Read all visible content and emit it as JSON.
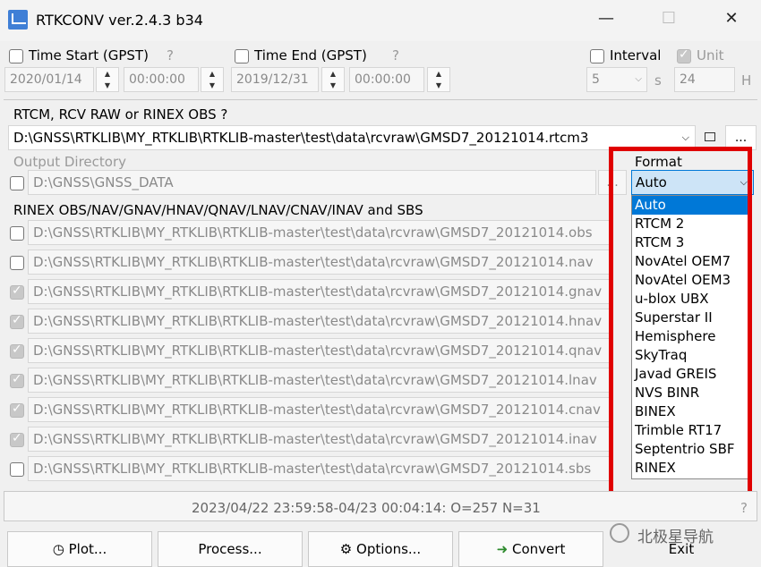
{
  "window": {
    "title": "RTKCONV ver.2.4.3 b34",
    "minimize": "—",
    "maximize": "☐",
    "close": "✕"
  },
  "time_start": {
    "label": "Time Start (GPST)",
    "help": "?",
    "date": "2020/01/14",
    "time": "00:00:00"
  },
  "time_end": {
    "label": "Time End (GPST)",
    "help": "?",
    "date": "2019/12/31",
    "time": "00:00:00"
  },
  "interval": {
    "label": "Interval",
    "value": "5",
    "unit": "s"
  },
  "unit": {
    "label": "Unit",
    "value": "24",
    "unit": "H"
  },
  "input": {
    "label": "RTCM, RCV RAW or RINEX OBS ?",
    "path": "D:\\GNSS\\RTKLIB\\MY_RTKLIB\\RTKLIB-master\\test\\data\\rcvraw\\GMSD7_20121014.rtcm3",
    "browse": "..."
  },
  "output_dir": {
    "label": "Output Directory",
    "path": "D:\\GNSS\\GNSS_DATA",
    "browse": "..."
  },
  "format": {
    "label": "Format",
    "selected": "Auto",
    "options": [
      "Auto",
      "RTCM 2",
      "RTCM 3",
      "NovAtel OEM7",
      "NovAtel OEM3",
      "u-blox UBX",
      "Superstar II",
      "Hemisphere",
      "SkyTraq",
      "Javad GREIS",
      "NVS BINR",
      "BINEX",
      "Trimble RT17",
      "Septentrio SBF",
      "RINEX"
    ]
  },
  "rinex": {
    "label": "RINEX OBS/NAV/GNAV/HNAV/QNAV/LNAV/CNAV/INAV and SBS",
    "files": [
      "D:\\GNSS\\RTKLIB\\MY_RTKLIB\\RTKLIB-master\\test\\data\\rcvraw\\GMSD7_20121014.obs",
      "D:\\GNSS\\RTKLIB\\MY_RTKLIB\\RTKLIB-master\\test\\data\\rcvraw\\GMSD7_20121014.nav",
      "D:\\GNSS\\RTKLIB\\MY_RTKLIB\\RTKLIB-master\\test\\data\\rcvraw\\GMSD7_20121014.gnav",
      "D:\\GNSS\\RTKLIB\\MY_RTKLIB\\RTKLIB-master\\test\\data\\rcvraw\\GMSD7_20121014.hnav",
      "D:\\GNSS\\RTKLIB\\MY_RTKLIB\\RTKLIB-master\\test\\data\\rcvraw\\GMSD7_20121014.qnav",
      "D:\\GNSS\\RTKLIB\\MY_RTKLIB\\RTKLIB-master\\test\\data\\rcvraw\\GMSD7_20121014.lnav",
      "D:\\GNSS\\RTKLIB\\MY_RTKLIB\\RTKLIB-master\\test\\data\\rcvraw\\GMSD7_20121014.cnav",
      "D:\\GNSS\\RTKLIB\\MY_RTKLIB\\RTKLIB-master\\test\\data\\rcvraw\\GMSD7_20121014.inav",
      "D:\\GNSS\\RTKLIB\\MY_RTKLIB\\RTKLIB-master\\test\\data\\rcvraw\\GMSD7_20121014.sbs"
    ]
  },
  "status": {
    "text": "2023/04/22 23:59:58-04/23 00:04:14: O=257 N=31",
    "help": "?"
  },
  "buttons": {
    "plot": "Plot...",
    "process": "Process...",
    "options": "Options...",
    "convert": "Convert",
    "exit": "Exit"
  },
  "watermark": "北极星导航",
  "colors": {
    "highlight": "#0078d7",
    "annotation": "#e00000",
    "convert_arrow": "#2e8b2e"
  }
}
